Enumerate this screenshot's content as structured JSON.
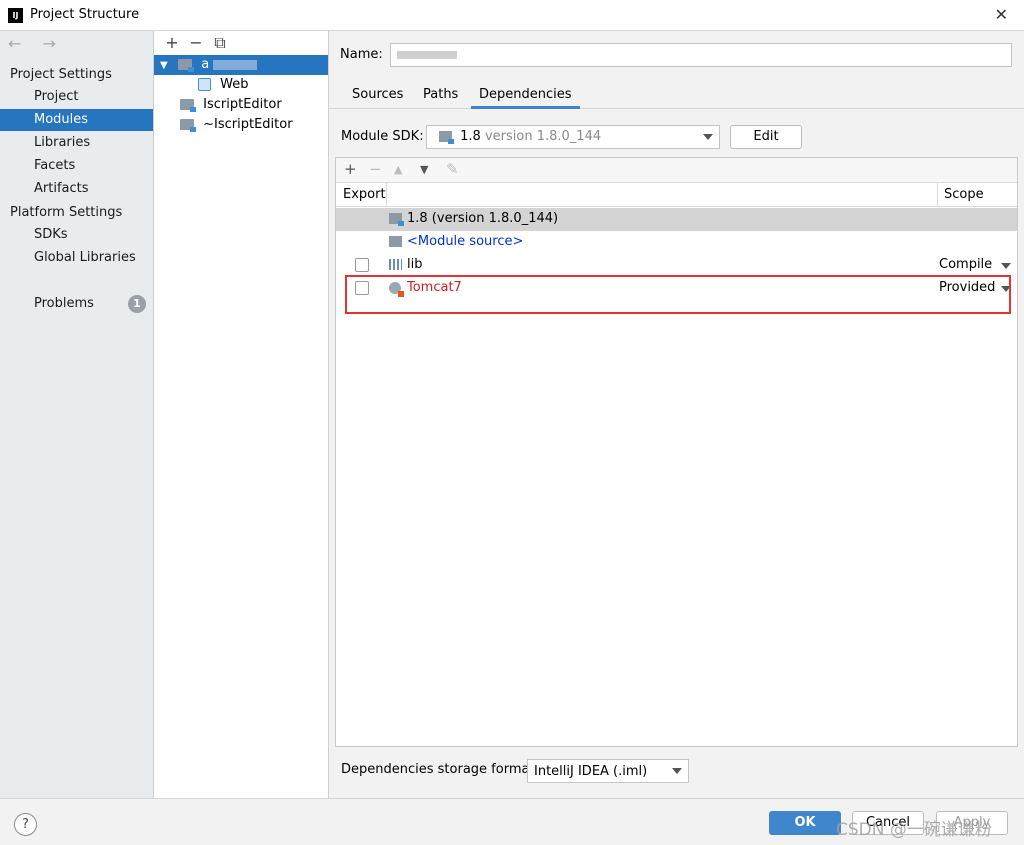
{
  "window": {
    "title": "Project Structure",
    "logo": "IJ",
    "close_glyph": "✕"
  },
  "nav": {
    "back_forward": "← →",
    "section_project": "Project Settings",
    "project_items": [
      "Project",
      "Modules",
      "Libraries",
      "Facets",
      "Artifacts"
    ],
    "selected": "Modules",
    "section_platform": "Platform Settings",
    "platform_items": [
      "SDKs",
      "Global Libraries"
    ],
    "problems_label": "Problems",
    "problems_count": "1"
  },
  "tree": {
    "toolbar": [
      "+",
      "−",
      "⧉"
    ],
    "items": [
      {
        "label": "a",
        "selected": true,
        "expanded": true
      },
      {
        "label": "Web"
      },
      {
        "label": "IscriptEditor"
      },
      {
        "label": "~IscriptEditor"
      }
    ]
  },
  "main": {
    "name_label": "Name:",
    "tabs": [
      "Sources",
      "Paths",
      "Dependencies"
    ],
    "active_tab": "Dependencies",
    "sdk_label": "Module SDK:",
    "sdk_value": "1.8",
    "sdk_version": "version 1.8.0_144",
    "edit_button": "Edit",
    "dep_toolbar": [
      "+",
      "−",
      "▲",
      "▼",
      "✎"
    ],
    "columns": {
      "export": "Export",
      "scope": "Scope"
    },
    "rows": [
      {
        "label": "1.8 (version 1.8.0_144)",
        "scope": "",
        "checkbox": false,
        "icon": "sdk-folder-icon",
        "color": "#000000",
        "selected": true
      },
      {
        "label": "<Module source>",
        "scope": "",
        "checkbox": false,
        "icon": "module-source-icon",
        "color": "#0033cc",
        "selected": false
      },
      {
        "label": "lib",
        "scope": "Compile",
        "checkbox": true,
        "icon": "library-icon",
        "color": "#000000",
        "selected": false
      },
      {
        "label": "Tomcat7",
        "scope": "Provided",
        "checkbox": true,
        "icon": "tomcat-globe-icon",
        "color": "#cc2222",
        "selected": false
      }
    ],
    "storage_label": "Dependencies storage format:",
    "storage_value": "IntelliJ IDEA (.iml)"
  },
  "footer": {
    "help": "?",
    "ok": "OK",
    "cancel": "Cancel",
    "apply": "Apply",
    "watermark": "CSDN @一碗谦谦粉"
  }
}
